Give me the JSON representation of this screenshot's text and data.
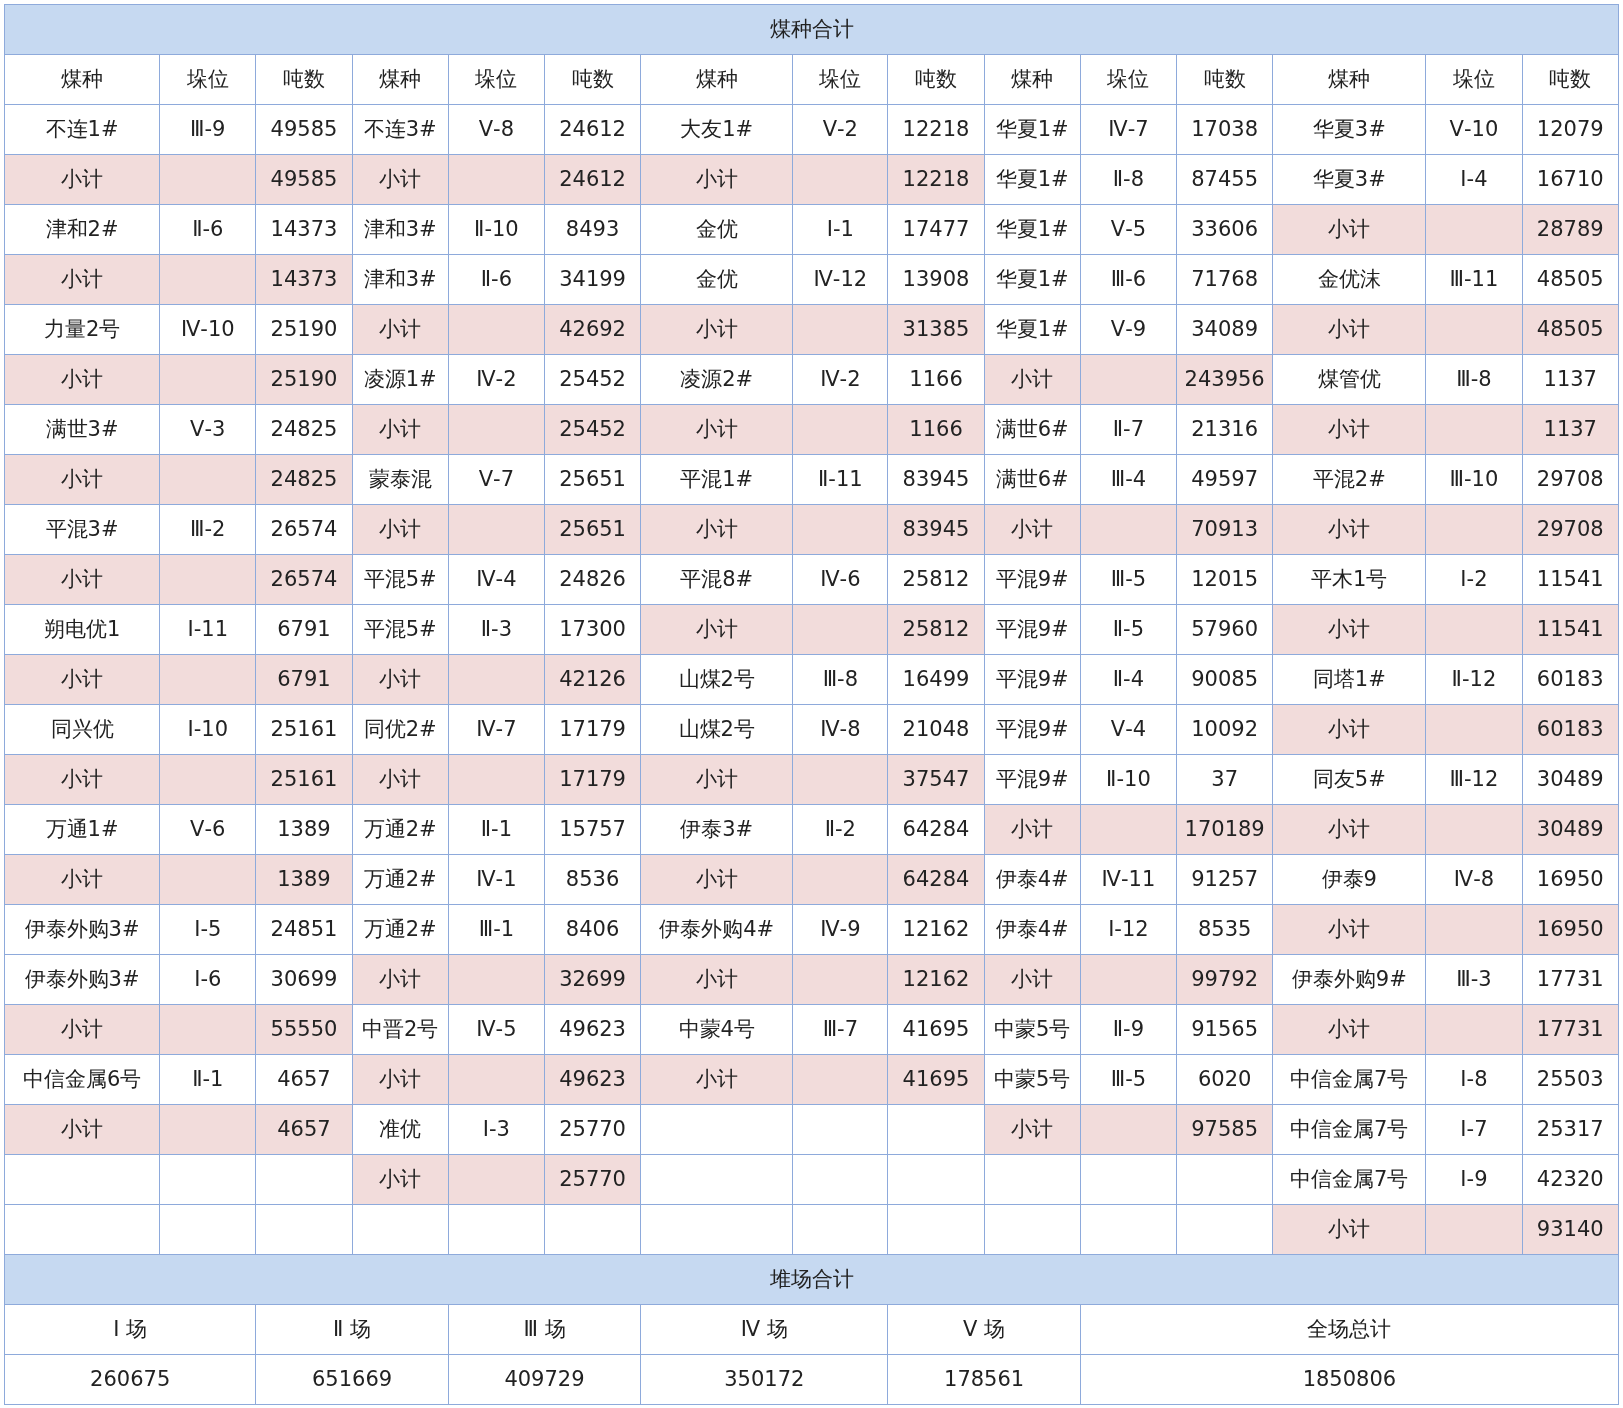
{
  "title": "煤种合计",
  "columns": [
    "煤种",
    "垛位",
    "吨数",
    "煤种",
    "垛位",
    "吨数",
    "煤种",
    "垛位",
    "吨数",
    "煤种",
    "垛位",
    "吨数",
    "煤种",
    "垛位",
    "吨数"
  ],
  "rows": [
    {
      "cells": [
        {
          "kind": "item",
          "name": "不连1#",
          "position": "Ⅲ-9",
          "tons": "49585"
        },
        {
          "kind": "item",
          "name": "不连3#",
          "position": "Ⅴ-8",
          "tons": "24612"
        },
        {
          "kind": "item",
          "name": "大友1#",
          "position": "Ⅴ-2",
          "tons": "12218"
        },
        {
          "kind": "item",
          "name": "华夏1#",
          "position": "Ⅳ-7",
          "tons": "17038"
        },
        {
          "kind": "item",
          "name": "华夏3#",
          "position": "Ⅴ-10",
          "tons": "12079"
        }
      ]
    },
    {
      "cells": [
        {
          "kind": "subtotal",
          "name": "小计",
          "tons": "49585"
        },
        {
          "kind": "subtotal",
          "name": "小计",
          "tons": "24612"
        },
        {
          "kind": "subtotal",
          "name": "小计",
          "tons": "12218"
        },
        {
          "kind": "item",
          "name": "华夏1#",
          "position": "Ⅱ-8",
          "tons": "87455"
        },
        {
          "kind": "item",
          "name": "华夏3#",
          "position": "Ⅰ-4",
          "tons": "16710"
        }
      ]
    },
    {
      "cells": [
        {
          "kind": "item",
          "name": "津和2#",
          "position": "Ⅱ-6",
          "tons": "14373"
        },
        {
          "kind": "item",
          "name": "津和3#",
          "position": "Ⅱ-10",
          "tons": "8493"
        },
        {
          "kind": "item",
          "name": "金优",
          "position": "Ⅰ-1",
          "tons": "17477"
        },
        {
          "kind": "item",
          "name": "华夏1#",
          "position": "Ⅴ-5",
          "tons": "33606"
        },
        {
          "kind": "subtotal",
          "name": "小计",
          "tons": "28789"
        }
      ]
    },
    {
      "cells": [
        {
          "kind": "subtotal",
          "name": "小计",
          "tons": "14373"
        },
        {
          "kind": "item",
          "name": "津和3#",
          "position": "Ⅱ-6",
          "tons": "34199"
        },
        {
          "kind": "item",
          "name": "金优",
          "position": "Ⅳ-12",
          "tons": "13908"
        },
        {
          "kind": "item",
          "name": "华夏1#",
          "position": "Ⅲ-6",
          "tons": "71768"
        },
        {
          "kind": "item",
          "name": "金优沫",
          "position": "Ⅲ-11",
          "tons": "48505"
        }
      ]
    },
    {
      "cells": [
        {
          "kind": "item",
          "name": "力量2号",
          "position": "Ⅳ-10",
          "tons": "25190"
        },
        {
          "kind": "subtotal",
          "name": "小计",
          "tons": "42692"
        },
        {
          "kind": "subtotal",
          "name": "小计",
          "tons": "31385"
        },
        {
          "kind": "item",
          "name": "华夏1#",
          "position": "Ⅴ-9",
          "tons": "34089"
        },
        {
          "kind": "subtotal",
          "name": "小计",
          "tons": "48505"
        }
      ]
    },
    {
      "cells": [
        {
          "kind": "subtotal",
          "name": "小计",
          "tons": "25190"
        },
        {
          "kind": "item",
          "name": "凌源1#",
          "position": "Ⅳ-2",
          "tons": "25452"
        },
        {
          "kind": "item",
          "name": "凌源2#",
          "position": "Ⅳ-2",
          "tons": "1166"
        },
        {
          "kind": "subtotal",
          "name": "小计",
          "tons": "243956"
        },
        {
          "kind": "item",
          "name": "煤管优",
          "position": "Ⅲ-8",
          "tons": "1137"
        }
      ]
    },
    {
      "cells": [
        {
          "kind": "item",
          "name": "满世3#",
          "position": "Ⅴ-3",
          "tons": "24825"
        },
        {
          "kind": "subtotal",
          "name": "小计",
          "tons": "25452"
        },
        {
          "kind": "subtotal",
          "name": "小计",
          "tons": "1166"
        },
        {
          "kind": "item",
          "name": "满世6#",
          "position": "Ⅱ-7",
          "tons": "21316"
        },
        {
          "kind": "subtotal",
          "name": "小计",
          "tons": "1137"
        }
      ]
    },
    {
      "cells": [
        {
          "kind": "subtotal",
          "name": "小计",
          "tons": "24825"
        },
        {
          "kind": "item",
          "name": "蒙泰混",
          "position": "Ⅴ-7",
          "tons": "25651"
        },
        {
          "kind": "item",
          "name": "平混1#",
          "position": "Ⅱ-11",
          "tons": "83945"
        },
        {
          "kind": "item",
          "name": "满世6#",
          "position": "Ⅲ-4",
          "tons": "49597"
        },
        {
          "kind": "item",
          "name": "平混2#",
          "position": "Ⅲ-10",
          "tons": "29708"
        }
      ]
    },
    {
      "cells": [
        {
          "kind": "item",
          "name": "平混3#",
          "position": "Ⅲ-2",
          "tons": "26574"
        },
        {
          "kind": "subtotal",
          "name": "小计",
          "tons": "25651"
        },
        {
          "kind": "subtotal",
          "name": "小计",
          "tons": "83945"
        },
        {
          "kind": "subtotal",
          "name": "小计",
          "tons": "70913"
        },
        {
          "kind": "subtotal",
          "name": "小计",
          "tons": "29708"
        }
      ]
    },
    {
      "cells": [
        {
          "kind": "subtotal",
          "name": "小计",
          "tons": "26574"
        },
        {
          "kind": "item",
          "name": "平混5#",
          "position": "Ⅳ-4",
          "tons": "24826"
        },
        {
          "kind": "item",
          "name": "平混8#",
          "position": "Ⅳ-6",
          "tons": "25812"
        },
        {
          "kind": "item",
          "name": "平混9#",
          "position": "Ⅲ-5",
          "tons": "12015"
        },
        {
          "kind": "item",
          "name": "平木1号",
          "position": "Ⅰ-2",
          "tons": "11541"
        }
      ]
    },
    {
      "cells": [
        {
          "kind": "item",
          "name": "朔电优1",
          "position": "Ⅰ-11",
          "tons": "6791"
        },
        {
          "kind": "item",
          "name": "平混5#",
          "position": "Ⅱ-3",
          "tons": "17300"
        },
        {
          "kind": "subtotal",
          "name": "小计",
          "tons": "25812"
        },
        {
          "kind": "item",
          "name": "平混9#",
          "position": "Ⅱ-5",
          "tons": "57960"
        },
        {
          "kind": "subtotal",
          "name": "小计",
          "tons": "11541"
        }
      ]
    },
    {
      "cells": [
        {
          "kind": "subtotal",
          "name": "小计",
          "tons": "6791"
        },
        {
          "kind": "subtotal",
          "name": "小计",
          "tons": "42126"
        },
        {
          "kind": "item",
          "name": "山煤2号",
          "position": "Ⅲ-8",
          "tons": "16499"
        },
        {
          "kind": "item",
          "name": "平混9#",
          "position": "Ⅱ-4",
          "tons": "90085"
        },
        {
          "kind": "item",
          "name": "同塔1#",
          "position": "Ⅱ-12",
          "tons": "60183"
        }
      ]
    },
    {
      "cells": [
        {
          "kind": "item",
          "name": "同兴优",
          "position": "Ⅰ-10",
          "tons": "25161"
        },
        {
          "kind": "item",
          "name": "同优2#",
          "position": "Ⅳ-7",
          "tons": "17179"
        },
        {
          "kind": "item",
          "name": "山煤2号",
          "position": "Ⅳ-8",
          "tons": "21048"
        },
        {
          "kind": "item",
          "name": "平混9#",
          "position": "Ⅴ-4",
          "tons": "10092"
        },
        {
          "kind": "subtotal",
          "name": "小计",
          "tons": "60183"
        }
      ]
    },
    {
      "cells": [
        {
          "kind": "subtotal",
          "name": "小计",
          "tons": "25161"
        },
        {
          "kind": "subtotal",
          "name": "小计",
          "tons": "17179"
        },
        {
          "kind": "subtotal",
          "name": "小计",
          "tons": "37547"
        },
        {
          "kind": "item",
          "name": "平混9#",
          "position": "Ⅱ-10",
          "tons": "37"
        },
        {
          "kind": "item",
          "name": "同友5#",
          "position": "Ⅲ-12",
          "tons": "30489"
        }
      ]
    },
    {
      "cells": [
        {
          "kind": "item",
          "name": "万通1#",
          "position": "Ⅴ-6",
          "tons": "1389"
        },
        {
          "kind": "item",
          "name": "万通2#",
          "position": "Ⅱ-1",
          "tons": "15757"
        },
        {
          "kind": "item",
          "name": "伊泰3#",
          "position": "Ⅱ-2",
          "tons": "64284"
        },
        {
          "kind": "subtotal",
          "name": "小计",
          "tons": "170189"
        },
        {
          "kind": "subtotal",
          "name": "小计",
          "tons": "30489"
        }
      ]
    },
    {
      "cells": [
        {
          "kind": "subtotal",
          "name": "小计",
          "tons": "1389"
        },
        {
          "kind": "item",
          "name": "万通2#",
          "position": "Ⅳ-1",
          "tons": "8536"
        },
        {
          "kind": "subtotal",
          "name": "小计",
          "tons": "64284"
        },
        {
          "kind": "item",
          "name": "伊泰4#",
          "position": "Ⅳ-11",
          "tons": "91257"
        },
        {
          "kind": "item",
          "name": "伊泰9",
          "position": "Ⅳ-8",
          "tons": "16950"
        }
      ]
    },
    {
      "cells": [
        {
          "kind": "item",
          "name": "伊泰外购3#",
          "position": "Ⅰ-5",
          "tons": "24851"
        },
        {
          "kind": "item",
          "name": "万通2#",
          "position": "Ⅲ-1",
          "tons": "8406"
        },
        {
          "kind": "item",
          "name": "伊泰外购4#",
          "position": "Ⅳ-9",
          "tons": "12162"
        },
        {
          "kind": "item",
          "name": "伊泰4#",
          "position": "Ⅰ-12",
          "tons": "8535"
        },
        {
          "kind": "subtotal",
          "name": "小计",
          "tons": "16950"
        }
      ]
    },
    {
      "cells": [
        {
          "kind": "item",
          "name": "伊泰外购3#",
          "position": "Ⅰ-6",
          "tons": "30699"
        },
        {
          "kind": "subtotal",
          "name": "小计",
          "tons": "32699"
        },
        {
          "kind": "subtotal",
          "name": "小计",
          "tons": "12162"
        },
        {
          "kind": "subtotal",
          "name": "小计",
          "tons": "99792"
        },
        {
          "kind": "item",
          "name": "伊泰外购9#",
          "position": "Ⅲ-3",
          "tons": "17731"
        }
      ]
    },
    {
      "cells": [
        {
          "kind": "subtotal",
          "name": "小计",
          "tons": "55550"
        },
        {
          "kind": "item",
          "name": "中晋2号",
          "position": "Ⅳ-5",
          "tons": "49623"
        },
        {
          "kind": "item",
          "name": "中蒙4号",
          "position": "Ⅲ-7",
          "tons": "41695"
        },
        {
          "kind": "item",
          "name": "中蒙5号",
          "position": "Ⅱ-9",
          "tons": "91565"
        },
        {
          "kind": "subtotal",
          "name": "小计",
          "tons": "17731"
        }
      ]
    },
    {
      "cells": [
        {
          "kind": "item",
          "name": "中信金属6号",
          "position": "Ⅱ-1",
          "tons": "4657"
        },
        {
          "kind": "subtotal",
          "name": "小计",
          "tons": "49623"
        },
        {
          "kind": "subtotal",
          "name": "小计",
          "tons": "41695"
        },
        {
          "kind": "item",
          "name": "中蒙5号",
          "position": "Ⅲ-5",
          "tons": "6020"
        },
        {
          "kind": "item",
          "name": "中信金属7号",
          "position": "Ⅰ-8",
          "tons": "25503"
        }
      ]
    },
    {
      "cells": [
        {
          "kind": "subtotal",
          "name": "小计",
          "tons": "4657"
        },
        {
          "kind": "item",
          "name": "准优",
          "position": "Ⅰ-3",
          "tons": "25770"
        },
        {
          "kind": "empty"
        },
        {
          "kind": "subtotal",
          "name": "小计",
          "tons": "97585"
        },
        {
          "kind": "item",
          "name": "中信金属7号",
          "position": "Ⅰ-7",
          "tons": "25317"
        }
      ]
    },
    {
      "cells": [
        {
          "kind": "empty"
        },
        {
          "kind": "subtotal",
          "name": "小计",
          "tons": "25770"
        },
        {
          "kind": "empty"
        },
        {
          "kind": "empty"
        },
        {
          "kind": "item",
          "name": "中信金属7号",
          "position": "Ⅰ-9",
          "tons": "42320"
        }
      ]
    },
    {
      "cells": [
        {
          "kind": "empty"
        },
        {
          "kind": "empty"
        },
        {
          "kind": "empty"
        },
        {
          "kind": "empty"
        },
        {
          "kind": "subtotal",
          "name": "小计",
          "tons": "93140"
        }
      ]
    }
  ],
  "yard_totals": {
    "title": "堆场合计",
    "columns": [
      "Ⅰ 场",
      "Ⅱ 场",
      "Ⅲ 场",
      "Ⅳ 场",
      "Ⅴ 场",
      "全场总计"
    ],
    "values": [
      "260675",
      "651669",
      "409729",
      "350172",
      "178561",
      "1850806"
    ]
  }
}
